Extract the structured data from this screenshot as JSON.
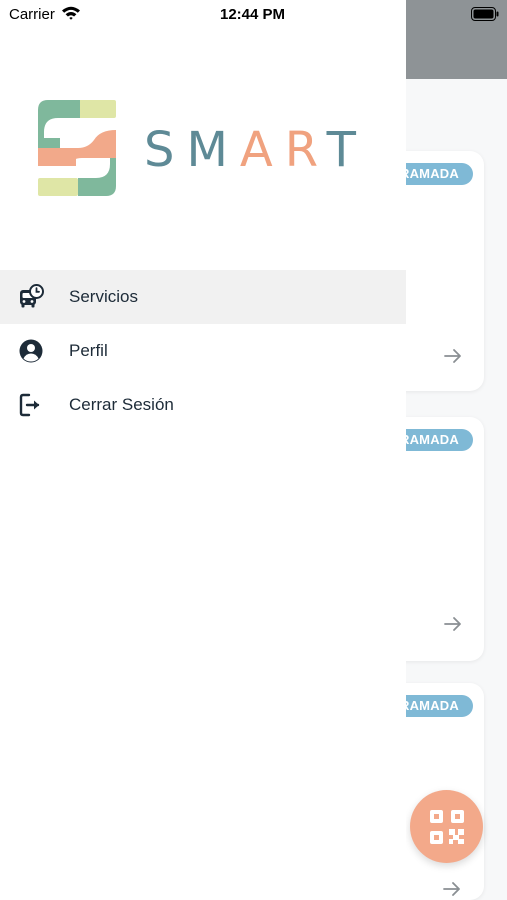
{
  "status_bar": {
    "carrier": "Carrier",
    "time": "12:44 PM"
  },
  "brand": {
    "letters": [
      "S",
      "M",
      "A",
      "R",
      "T"
    ]
  },
  "menu": {
    "items": [
      {
        "label": "Servicios",
        "icon": "bus-clock-icon",
        "active": true
      },
      {
        "label": "Perfil",
        "icon": "user-circle-icon",
        "active": false
      },
      {
        "label": "Cerrar Sesión",
        "icon": "logout-icon",
        "active": false
      }
    ]
  },
  "background": {
    "cards": [
      {
        "badge": "RAMADA"
      },
      {
        "badge": "RAMADA"
      },
      {
        "badge": "RAMADA"
      }
    ],
    "fab_icon": "qr-code-icon"
  },
  "colors": {
    "brand_teal": "#5e8a96",
    "brand_orange": "#f0a27f",
    "badge_blue": "#7fb9d6",
    "fab_orange": "#f3a98a"
  }
}
